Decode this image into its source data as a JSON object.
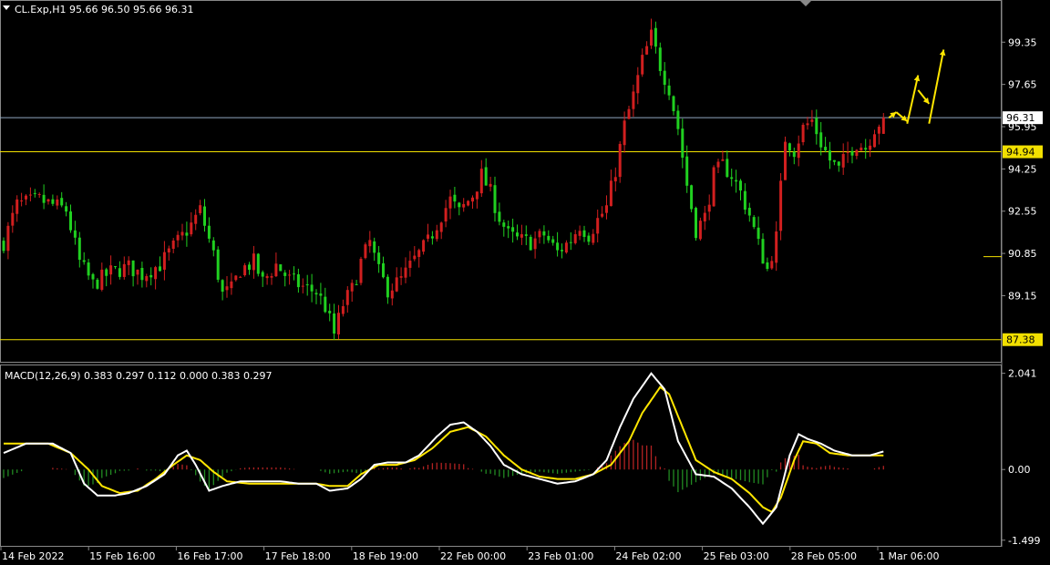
{
  "header": {
    "symbol_line": "CL.Exp,H1  95.66 96.50 95.66 96.31",
    "macd_line": "MACD(12,26,9) 0.383 0.297 0.112 0.000 0.383 0.297"
  },
  "colors": {
    "background": "#000000",
    "bull": "#d11f1f",
    "bear": "#20d020",
    "level": "#f2e000",
    "bid_line": "#8fa7bf",
    "macd_main": "#ffffff",
    "macd_signal": "#ffe600",
    "hist_pos": "#b22222",
    "hist_neg": "#228b22",
    "forecast_arrow": "#ffe600"
  },
  "chart_data": [
    {
      "type": "candlestick",
      "symbol": "CL.Exp",
      "timeframe": "H1",
      "ohlc": {
        "open": 95.66,
        "high": 96.5,
        "low": 95.66,
        "close": 96.31
      },
      "ylim": [
        86.6,
        100.9
      ],
      "y_ticks": [
        "99.35",
        "97.65",
        "95.95",
        "94.25",
        "92.55",
        "90.85",
        "89.15"
      ],
      "x_ticks": [
        "14 Feb 2022",
        "15 Feb 16:00",
        "16 Feb 17:00",
        "17 Feb 18:00",
        "18 Feb 19:00",
        "22 Feb 00:00",
        "23 Feb 01:00",
        "24 Feb 02:00",
        "25 Feb 03:00",
        "28 Feb 05:00",
        "1 Mar 06:00"
      ],
      "tagged_levels": [
        {
          "label": "96.31",
          "value": 96.31,
          "kind": "bid"
        },
        {
          "label": "94.94",
          "value": 94.94,
          "kind": "horizontal"
        },
        {
          "label": "87.38",
          "value": 87.38,
          "kind": "horizontal"
        }
      ],
      "untagged_levels": [
        {
          "value": 90.72,
          "from_x_index": 0.58
        }
      ],
      "close_path": [
        [
          0,
          91.3
        ],
        [
          3,
          92.8
        ],
        [
          8,
          93.0
        ],
        [
          14,
          92.6
        ],
        [
          17,
          90.5
        ],
        [
          20,
          89.6
        ],
        [
          24,
          90.1
        ],
        [
          28,
          90.3
        ],
        [
          31,
          90.0
        ],
        [
          35,
          90.4
        ],
        [
          38,
          91.1
        ],
        [
          42,
          92.0
        ],
        [
          44,
          92.6
        ],
        [
          47,
          90.8
        ],
        [
          49,
          89.2
        ],
        [
          51,
          89.4
        ],
        [
          53,
          90.2
        ],
        [
          56,
          90.5
        ],
        [
          58,
          89.7
        ],
        [
          61,
          90.4
        ],
        [
          64,
          89.8
        ],
        [
          67,
          89.5
        ],
        [
          70,
          89.3
        ],
        [
          72,
          88.7
        ],
        [
          74,
          87.6
        ],
        [
          76,
          88.8
        ],
        [
          78,
          89.4
        ],
        [
          80,
          90.5
        ],
        [
          82,
          91.3
        ],
        [
          84,
          90.1
        ],
        [
          86,
          89.4
        ],
        [
          89,
          89.8
        ],
        [
          92,
          90.6
        ],
        [
          95,
          91.3
        ],
        [
          98,
          92.4
        ],
        [
          100,
          93.0
        ],
        [
          102,
          92.5
        ],
        [
          105,
          93.2
        ],
        [
          107,
          94.0
        ],
        [
          109,
          93.3
        ],
        [
          111,
          92.3
        ],
        [
          113,
          91.6
        ],
        [
          115,
          91.4
        ],
        [
          118,
          91.3
        ],
        [
          121,
          91.6
        ],
        [
          124,
          90.9
        ],
        [
          127,
          91.4
        ],
        [
          129,
          92.0
        ],
        [
          131,
          91.6
        ],
        [
          133,
          92.2
        ],
        [
          135,
          92.7
        ],
        [
          137,
          94.2
        ],
        [
          139,
          96.0
        ],
        [
          141,
          97.2
        ],
        [
          143,
          98.6
        ],
        [
          145,
          99.6
        ],
        [
          147,
          98.4
        ],
        [
          149,
          97.5
        ],
        [
          151,
          95.9
        ],
        [
          153,
          93.6
        ],
        [
          155,
          91.8
        ],
        [
          157,
          92.3
        ],
        [
          159,
          94.0
        ],
        [
          161,
          94.4
        ],
        [
          163,
          94.0
        ],
        [
          165,
          93.3
        ],
        [
          167,
          92.4
        ],
        [
          169,
          91.2
        ],
        [
          171,
          90.2
        ],
        [
          173,
          91.5
        ],
        [
          175,
          95.5
        ],
        [
          177,
          95.0
        ],
        [
          179,
          95.9
        ],
        [
          181,
          96.2
        ],
        [
          183,
          95.3
        ],
        [
          185,
          94.6
        ],
        [
          187,
          94.2
        ],
        [
          189,
          94.9
        ],
        [
          191,
          95.3
        ],
        [
          193,
          95.1
        ],
        [
          195,
          95.9
        ],
        [
          197,
          96.31
        ]
      ],
      "forecast_arrows_count": 4
    },
    {
      "type": "line",
      "indicator": "MACD(12,26,9)",
      "values": {
        "macd": 0.383,
        "signal": 0.297,
        "histogram": 0.112,
        "d4": 0.0,
        "d5": 0.383,
        "d6": 0.297
      },
      "ylim": [
        -1.6,
        2.15
      ],
      "y_ticks": [
        "2.041",
        "0.00",
        "-1.499"
      ],
      "series": [
        {
          "name": "MACD(12,26,9)",
          "points": [
            [
              0,
              0.35
            ],
            [
              5,
              0.55
            ],
            [
              11,
              0.55
            ],
            [
              15,
              0.35
            ],
            [
              18,
              -0.3
            ],
            [
              21,
              -0.55
            ],
            [
              25,
              -0.55
            ],
            [
              28,
              -0.5
            ],
            [
              32,
              -0.35
            ],
            [
              36,
              -0.1
            ],
            [
              39,
              0.3
            ],
            [
              41,
              0.4
            ],
            [
              43,
              0.1
            ],
            [
              46,
              -0.45
            ],
            [
              49,
              -0.35
            ],
            [
              53,
              -0.25
            ],
            [
              58,
              -0.25
            ],
            [
              62,
              -0.25
            ],
            [
              66,
              -0.3
            ],
            [
              70,
              -0.3
            ],
            [
              73,
              -0.45
            ],
            [
              77,
              -0.4
            ],
            [
              80,
              -0.2
            ],
            [
              83,
              0.1
            ],
            [
              86,
              0.15
            ],
            [
              90,
              0.15
            ],
            [
              93,
              0.3
            ],
            [
              97,
              0.7
            ],
            [
              100,
              0.95
            ],
            [
              103,
              1.0
            ],
            [
              106,
              0.8
            ],
            [
              109,
              0.5
            ],
            [
              112,
              0.1
            ],
            [
              116,
              -0.1
            ],
            [
              120,
              -0.2
            ],
            [
              124,
              -0.3
            ],
            [
              128,
              -0.25
            ],
            [
              132,
              -0.1
            ],
            [
              135,
              0.2
            ],
            [
              138,
              0.9
            ],
            [
              141,
              1.5
            ],
            [
              145,
              2.04
            ],
            [
              148,
              1.7
            ],
            [
              151,
              0.6
            ],
            [
              155,
              -0.1
            ],
            [
              159,
              -0.15
            ],
            [
              163,
              -0.4
            ],
            [
              167,
              -0.8
            ],
            [
              170,
              -1.15
            ],
            [
              173,
              -0.8
            ],
            [
              176,
              0.3
            ],
            [
              178,
              0.75
            ],
            [
              180,
              0.65
            ],
            [
              183,
              0.55
            ],
            [
              186,
              0.4
            ],
            [
              190,
              0.3
            ],
            [
              194,
              0.3
            ],
            [
              197,
              0.383
            ]
          ]
        },
        {
          "name": "Signal",
          "points": [
            [
              0,
              0.55
            ],
            [
              4,
              0.55
            ],
            [
              10,
              0.55
            ],
            [
              15,
              0.35
            ],
            [
              19,
              0.0
            ],
            [
              22,
              -0.35
            ],
            [
              26,
              -0.5
            ],
            [
              30,
              -0.45
            ],
            [
              34,
              -0.2
            ],
            [
              38,
              0.1
            ],
            [
              41,
              0.3
            ],
            [
              44,
              0.2
            ],
            [
              47,
              -0.05
            ],
            [
              50,
              -0.25
            ],
            [
              55,
              -0.3
            ],
            [
              60,
              -0.3
            ],
            [
              65,
              -0.3
            ],
            [
              70,
              -0.3
            ],
            [
              73,
              -0.35
            ],
            [
              77,
              -0.35
            ],
            [
              80,
              -0.1
            ],
            [
              84,
              0.1
            ],
            [
              88,
              0.1
            ],
            [
              92,
              0.2
            ],
            [
              96,
              0.45
            ],
            [
              100,
              0.8
            ],
            [
              104,
              0.9
            ],
            [
              108,
              0.7
            ],
            [
              112,
              0.3
            ],
            [
              116,
              0.0
            ],
            [
              120,
              -0.15
            ],
            [
              124,
              -0.2
            ],
            [
              128,
              -0.2
            ],
            [
              132,
              -0.1
            ],
            [
              136,
              0.1
            ],
            [
              140,
              0.6
            ],
            [
              143,
              1.2
            ],
            [
              147,
              1.75
            ],
            [
              149,
              1.6
            ],
            [
              152,
              0.9
            ],
            [
              155,
              0.2
            ],
            [
              159,
              -0.05
            ],
            [
              163,
              -0.2
            ],
            [
              167,
              -0.5
            ],
            [
              170,
              -0.8
            ],
            [
              172,
              -0.9
            ],
            [
              174,
              -0.6
            ],
            [
              177,
              0.2
            ],
            [
              179,
              0.6
            ],
            [
              182,
              0.55
            ],
            [
              185,
              0.35
            ],
            [
              189,
              0.3
            ],
            [
              193,
              0.3
            ],
            [
              197,
              0.297
            ]
          ]
        }
      ]
    }
  ]
}
